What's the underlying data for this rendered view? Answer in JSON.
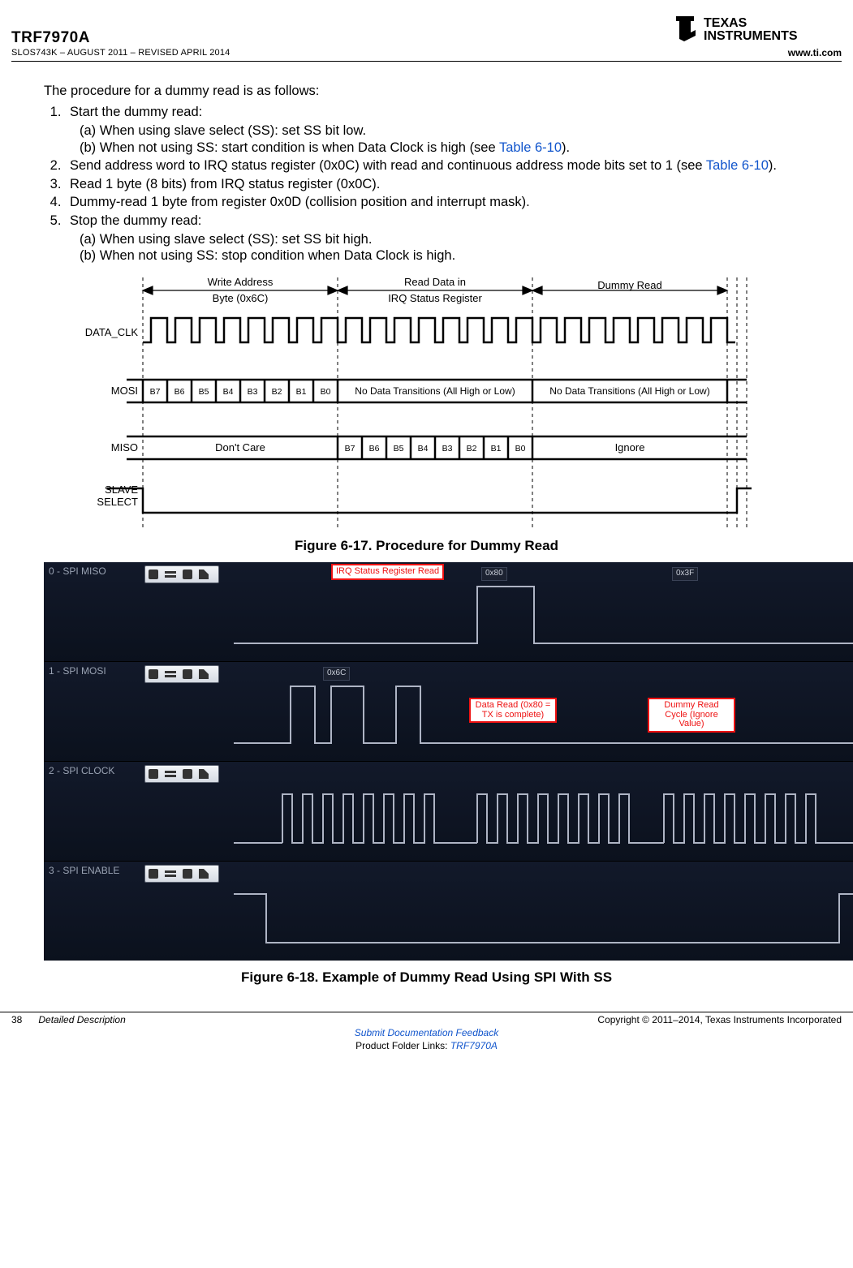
{
  "header": {
    "partNumber": "TRF7970A",
    "revision": "SLOS743K – AUGUST 2011 – REVISED APRIL 2014",
    "company": "TEXAS INSTRUMENTS",
    "url": "www.ti.com"
  },
  "body": {
    "intro": "The procedure for a dummy read is as follows:",
    "steps": {
      "s1": "Start the dummy read:",
      "s1a_pre": "(a)  When using slave select (SS): set SS bit low.",
      "s1b_pre": "(b)  When not using SS: start condition is when Data Clock is high (see ",
      "s1b_link": "Table 6-10",
      "s1b_post": ").",
      "s2_pre": "Send address word to IRQ status register (0x0C) with read and continuous address mode bits set to 1 (see ",
      "s2_link": "Table 6-10",
      "s2_post": ").",
      "s3": "Read 1 byte (8 bits) from IRQ status register (0x0C).",
      "s4": "Dummy-read 1 byte from register 0x0D (collision position and interrupt mask).",
      "s5": "Stop the dummy read:",
      "s5a": "(a)  When using slave select (SS): set SS bit high.",
      "s5b": "(b)  When not using SS: stop condition when Data Clock is high."
    }
  },
  "fig17": {
    "caption": "Figure 6-17. Procedure for Dummy Read",
    "seg1_l1": "Write Address",
    "seg1_l2": "Byte (0x6C)",
    "seg2_l1": "Read Data in",
    "seg2_l2": "IRQ Status Register",
    "seg3": "Dummy Read",
    "sig_clk": "DATA_CLK",
    "sig_mosi": "MOSI",
    "sig_miso": "MISO",
    "sig_ss_l1": "SLAVE",
    "sig_ss_l2": "SELECT",
    "mosi_seg2": "No Data Transitions (All High or Low)",
    "mosi_seg3": "No Data Transitions (All High or Low)",
    "miso_seg1": "Don't Care",
    "miso_seg3": "Ignore",
    "bits": [
      "B7",
      "B6",
      "B5",
      "B4",
      "B3",
      "B2",
      "B1",
      "B0"
    ]
  },
  "fig18": {
    "caption": "Figure 6-18. Example of Dummy Read Using SPI With SS",
    "ch0": "0 - SPI MISO",
    "ch1": "1 - SPI MOSI",
    "ch2": "2 - SPI CLOCK",
    "ch3": "3 - SPI ENABLE",
    "callout_irq": "IRQ Status Register Read",
    "callout_data": "Data Read (0x80 = TX is complete)",
    "callout_dummy": "Dummy Read Cycle (Ignore Value)",
    "mosi_byte": "0x6C",
    "miso_b1": "0x80",
    "miso_b2": "0x3F"
  },
  "footer": {
    "page": "38",
    "section": "Detailed Description",
    "feedback": "Submit Documentation Feedback",
    "folder_pre": "Product Folder Links: ",
    "folder_link": "TRF7970A",
    "copyright": "Copyright © 2011–2014, Texas Instruments Incorporated"
  }
}
